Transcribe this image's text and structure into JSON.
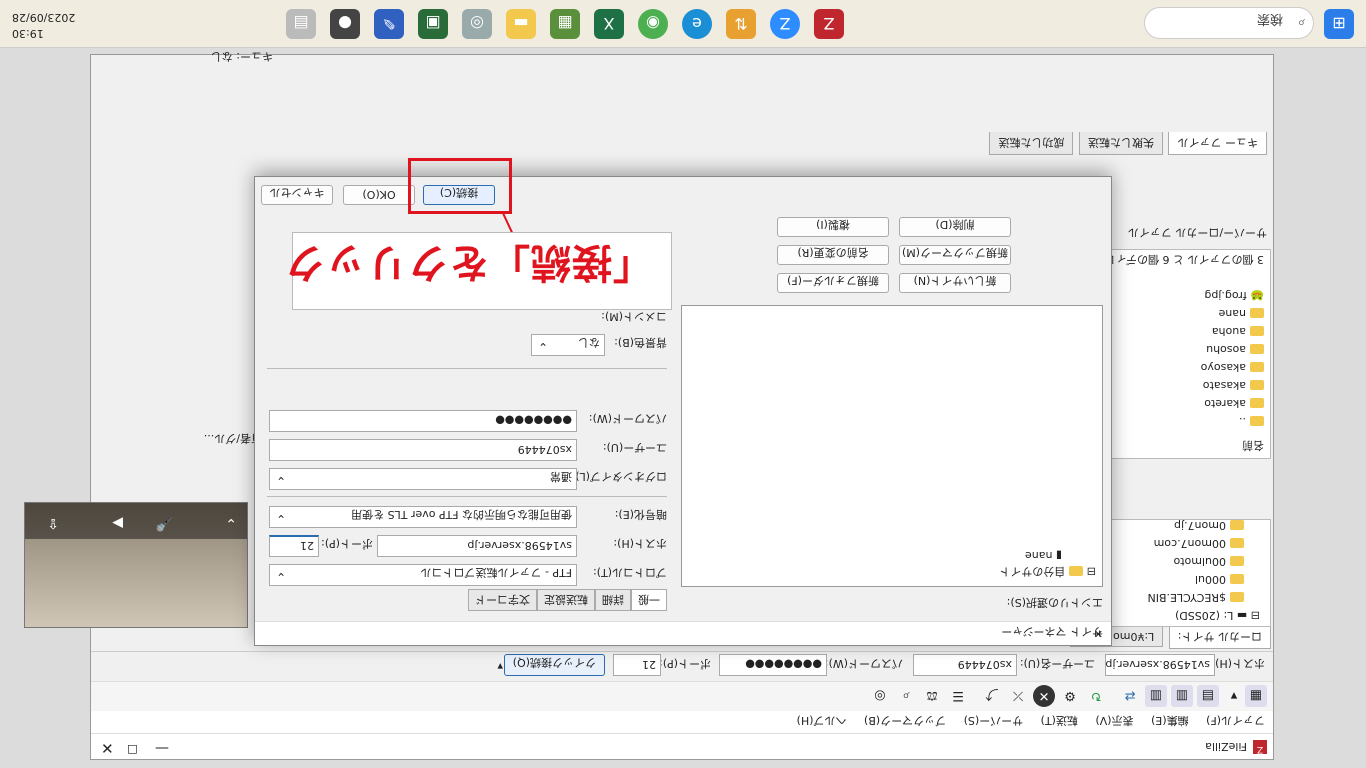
{
  "taskbar": {
    "search_placeholder": "検索",
    "time": "19:30",
    "date": "2023/09/28",
    "icons": [
      "windows-start-icon",
      "search-icon",
      "filezilla-icon",
      "zoom-icon",
      "ftp-icon",
      "edge-icon",
      "chrome-icon",
      "excel-icon",
      "network-icon",
      "folder-icon",
      "webcam-icon",
      "cpu-icon",
      "paint-icon",
      "camera-icon",
      "book-icon"
    ]
  },
  "window": {
    "title": "FileZilla",
    "menu": [
      "ファイル(F)",
      "編集(E)",
      "表示(V)",
      "転送(T)",
      "サーバー(S)",
      "ブックマーク(B)",
      "ヘルプ(H)"
    ],
    "quickconnect": {
      "host_label": "ホスト(H):",
      "host_value": "sv14598.xserver.jp",
      "user_label": "ユーザー名(U):",
      "user_value": "xs074449",
      "pass_label": "パスワード(W):",
      "pass_value": "●●●●●●●●",
      "port_label": "ポート(P):",
      "port_value": "21",
      "button": "クイック接続(Q)"
    },
    "local_tabs": [
      "ローカル サイト:",
      "L:¥0mon7.jp¥"
    ],
    "local_tree": [
      "L: (20SSD)",
      "$RECYCLE.BIN",
      "000ul",
      "00ulmoto",
      "00mon7.com",
      "0mon7.jp"
    ],
    "local_files_header": "名前",
    "local_files": [
      "..",
      "akareto",
      "akasato",
      "akasoyo",
      "aosohu",
      "auoha",
      "nane",
      "frog.jpg"
    ],
    "local_status": "3 個のファイル と 6 個のディレクトリ",
    "remote_header": "所有者/グル...",
    "queue_tabs": [
      "キュー ファイル",
      "失敗した転送",
      "成功した転送"
    ],
    "queue_status": "キュー: なし",
    "server_local_label": "サーバー/ローカル ファイル"
  },
  "dialog": {
    "title": "サイト マネージャー",
    "entry_label": "エントリの選択(S):",
    "tree": {
      "root": "自分のサイト",
      "site": "nane"
    },
    "buttons_left": [
      "新しいサイト(N)",
      "新規フォルダー(F)",
      "新規ブックマーク(M)",
      "名前の変更(R)",
      "削除(D)",
      "複製(I)"
    ],
    "tabs": [
      "一般",
      "詳細",
      "転送設定",
      "文字コード"
    ],
    "protocol_label": "プロトコル(T):",
    "protocol_value": "FTP - ファイル転送プロトコル",
    "host_label": "ホスト(H):",
    "host_value": "sv14598.xserver.jp",
    "port_label": "ポート(P):",
    "port_value": "21",
    "encryption_label": "暗号化(E):",
    "encryption_value": "使用可能なら明示的な FTP over TLS を使用",
    "logon_label": "ログオンタイプ(L):",
    "logon_value": "通常",
    "user_label": "ユーザー(U):",
    "user_value": "xs074449",
    "password_label": "パスワード(W):",
    "password_value": "●●●●●●●●",
    "bgcolor_label": "背景色(B):",
    "bgcolor_value": "なし",
    "comment_label": "コメント(M):",
    "connect_button": "接続(C)",
    "ok_button": "OK(O)",
    "cancel_button": "キャンセル"
  },
  "annotation": {
    "text": "「接続」をクリック"
  },
  "colors": {
    "annotation": "#e0141e",
    "accent": "#2b6cb0"
  }
}
